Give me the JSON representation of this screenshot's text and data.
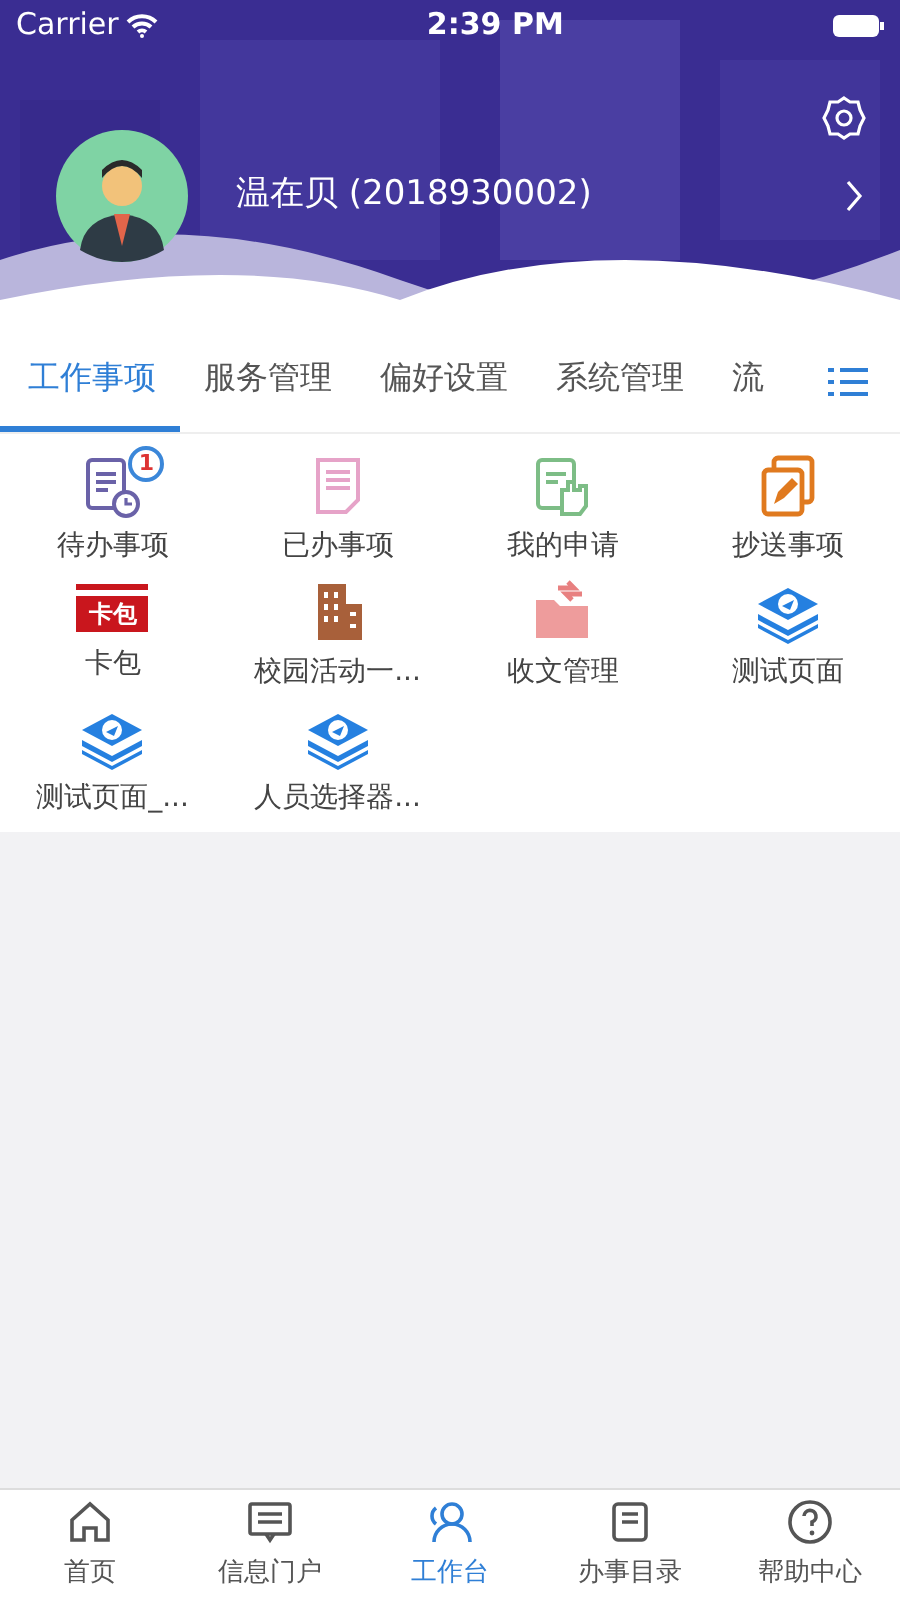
{
  "status_bar": {
    "carrier": "Carrier",
    "time": "2:39 PM"
  },
  "profile": {
    "name": "温在贝 (2018930002)"
  },
  "tabs": [
    {
      "label": "工作事项",
      "selected": true
    },
    {
      "label": "服务管理",
      "selected": false
    },
    {
      "label": "偏好设置",
      "selected": false
    },
    {
      "label": "系统管理",
      "selected": false
    },
    {
      "label": "流",
      "selected": false
    }
  ],
  "apps": [
    {
      "label": "待办事项",
      "kind": "list",
      "badge": "1"
    },
    {
      "label": "已办事项",
      "kind": "doc"
    },
    {
      "label": "我的申请",
      "kind": "hand"
    },
    {
      "label": "抄送事项",
      "kind": "copy"
    },
    {
      "label": "卡包",
      "kind": "card",
      "icon_text": "卡包"
    },
    {
      "label": "校园活动一...",
      "kind": "building"
    },
    {
      "label": "收文管理",
      "kind": "folder"
    },
    {
      "label": "测试页面",
      "kind": "layers"
    },
    {
      "label": "测试页面_...",
      "kind": "layers"
    },
    {
      "label": "人员选择器...",
      "kind": "layers"
    }
  ],
  "bottom_nav": [
    {
      "label": "首页",
      "kind": "home",
      "selected": false
    },
    {
      "label": "信息门户",
      "kind": "message",
      "selected": false
    },
    {
      "label": "工作台",
      "kind": "people",
      "selected": true
    },
    {
      "label": "办事目录",
      "kind": "book",
      "selected": false
    },
    {
      "label": "帮助中心",
      "kind": "help",
      "selected": false
    }
  ]
}
